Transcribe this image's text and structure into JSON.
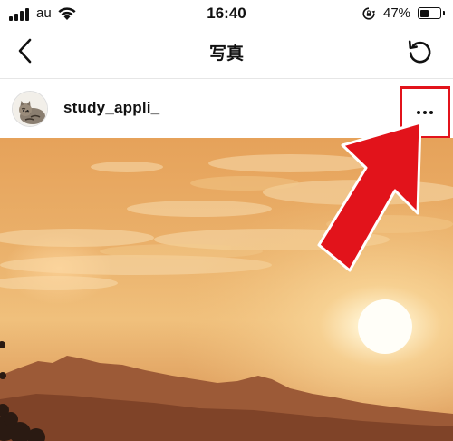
{
  "status_bar": {
    "carrier": "au",
    "time": "16:40",
    "battery_percent": "47%",
    "battery_level": 0.47,
    "icons": [
      "signal-icon",
      "wifi-icon",
      "orientation-lock-icon",
      "battery-icon"
    ]
  },
  "nav": {
    "title": "写真",
    "icons": [
      "back-chevron-icon",
      "refresh-icon"
    ]
  },
  "post": {
    "username": "study_appli_",
    "more_icon": "ellipsis-icon",
    "avatar": "cat-avatar",
    "image": "sunset-over-mountains-photo"
  },
  "annotation": {
    "highlight_color": "#e2131b",
    "arrow_color": "#e2131b",
    "arrow": "red-arrow-pointing-to-more-button"
  }
}
